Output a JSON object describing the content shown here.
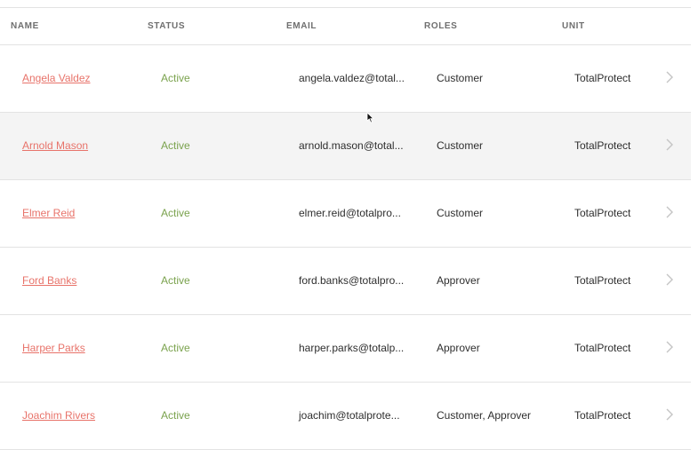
{
  "headers": {
    "name": "NAME",
    "status": "STATUS",
    "email": "EMAIL",
    "roles": "ROLES",
    "unit": "UNIT"
  },
  "rows": [
    {
      "name": "Angela Valdez",
      "status": "Active",
      "email": "angela.valdez@total...",
      "roles": "Customer",
      "unit": "TotalProtect"
    },
    {
      "name": "Arnold Mason",
      "status": "Active",
      "email": "arnold.mason@total...",
      "roles": "Customer",
      "unit": "TotalProtect"
    },
    {
      "name": "Elmer Reid",
      "status": "Active",
      "email": "elmer.reid@totalpro...",
      "roles": "Customer",
      "unit": "TotalProtect"
    },
    {
      "name": "Ford Banks",
      "status": "Active",
      "email": "ford.banks@totalpro...",
      "roles": "Approver",
      "unit": "TotalProtect"
    },
    {
      "name": "Harper Parks",
      "status": "Active",
      "email": "harper.parks@totalp...",
      "roles": "Approver",
      "unit": "TotalProtect"
    },
    {
      "name": "Joachim Rivers",
      "status": "Active",
      "email": "joachim@totalprote...",
      "roles": "Customer, Approver",
      "unit": "TotalProtect"
    }
  ],
  "colors": {
    "name_link": "#e8736a",
    "status_active": "#7aa24d",
    "hover_row": "#f4f4f4",
    "header_text": "#6f6f6f"
  },
  "icons": {
    "row_action": "chevron-right-icon",
    "pointer": "mouse-cursor-icon"
  },
  "hovered_row_index": 1
}
